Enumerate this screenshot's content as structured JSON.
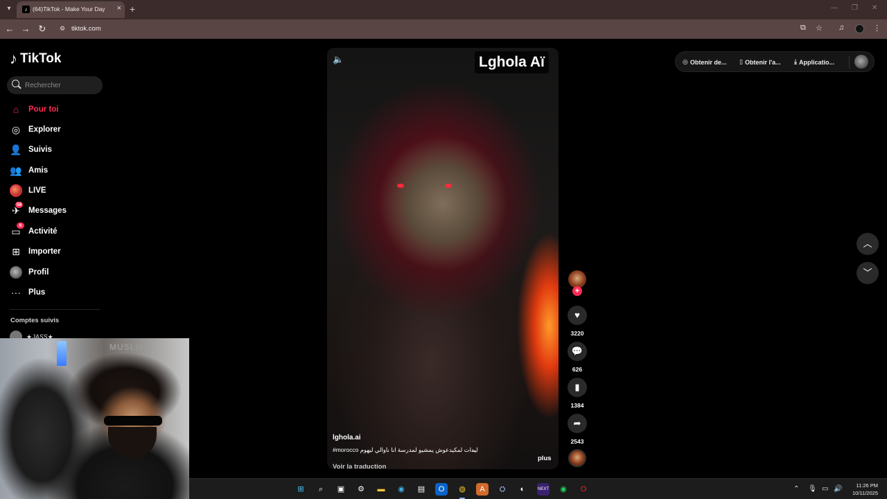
{
  "browser": {
    "tab_title": "(64)TikTok - Make Your Day",
    "url": "tiktok.com"
  },
  "sidebar": {
    "logo": "TikTok",
    "search_placeholder": "Rechercher",
    "items": [
      {
        "label": "Pour toi",
        "icon": "home-icon",
        "active": true
      },
      {
        "label": "Explorer",
        "icon": "compass-icon"
      },
      {
        "label": "Suivis",
        "icon": "following-icon"
      },
      {
        "label": "Amis",
        "icon": "friends-icon"
      },
      {
        "label": "LIVE",
        "icon": "live-icon"
      },
      {
        "label": "Messages",
        "icon": "messages-icon",
        "badge": "58"
      },
      {
        "label": "Activité",
        "icon": "activity-icon",
        "badge": "6"
      },
      {
        "label": "Importer",
        "icon": "upload-icon"
      },
      {
        "label": "Profil",
        "icon": "profile-icon"
      },
      {
        "label": "Plus",
        "icon": "more-icon"
      }
    ],
    "followed_title": "Comptes suivis",
    "followed": [
      {
        "name": "★JASS★"
      }
    ]
  },
  "video": {
    "watermark": "Lghola Aï",
    "author": "lghola.ai",
    "caption": "#morocco لواليدات لمكيدعوش يمشيو لمدرسة انا ناوالي ليهوم",
    "caption_ellipsis": "...",
    "translate": "Voir la traduction",
    "more": "plus",
    "likes": "3220",
    "comments": "626",
    "saves": "1384",
    "shares": "2543"
  },
  "top_actions": {
    "item1": "Obtenir de...",
    "item2": "Obtenir l'a...",
    "item3": "Applicatio..."
  },
  "webcam": {
    "sign_text": "MUSLIM"
  },
  "taskbar": {
    "time": "11:26 PM",
    "date": "10/11/2025"
  },
  "colors": {
    "accent": "#fe2c55",
    "chrome_tab_bar": "#3b2b2b",
    "chrome_toolbar": "#5a4545"
  }
}
